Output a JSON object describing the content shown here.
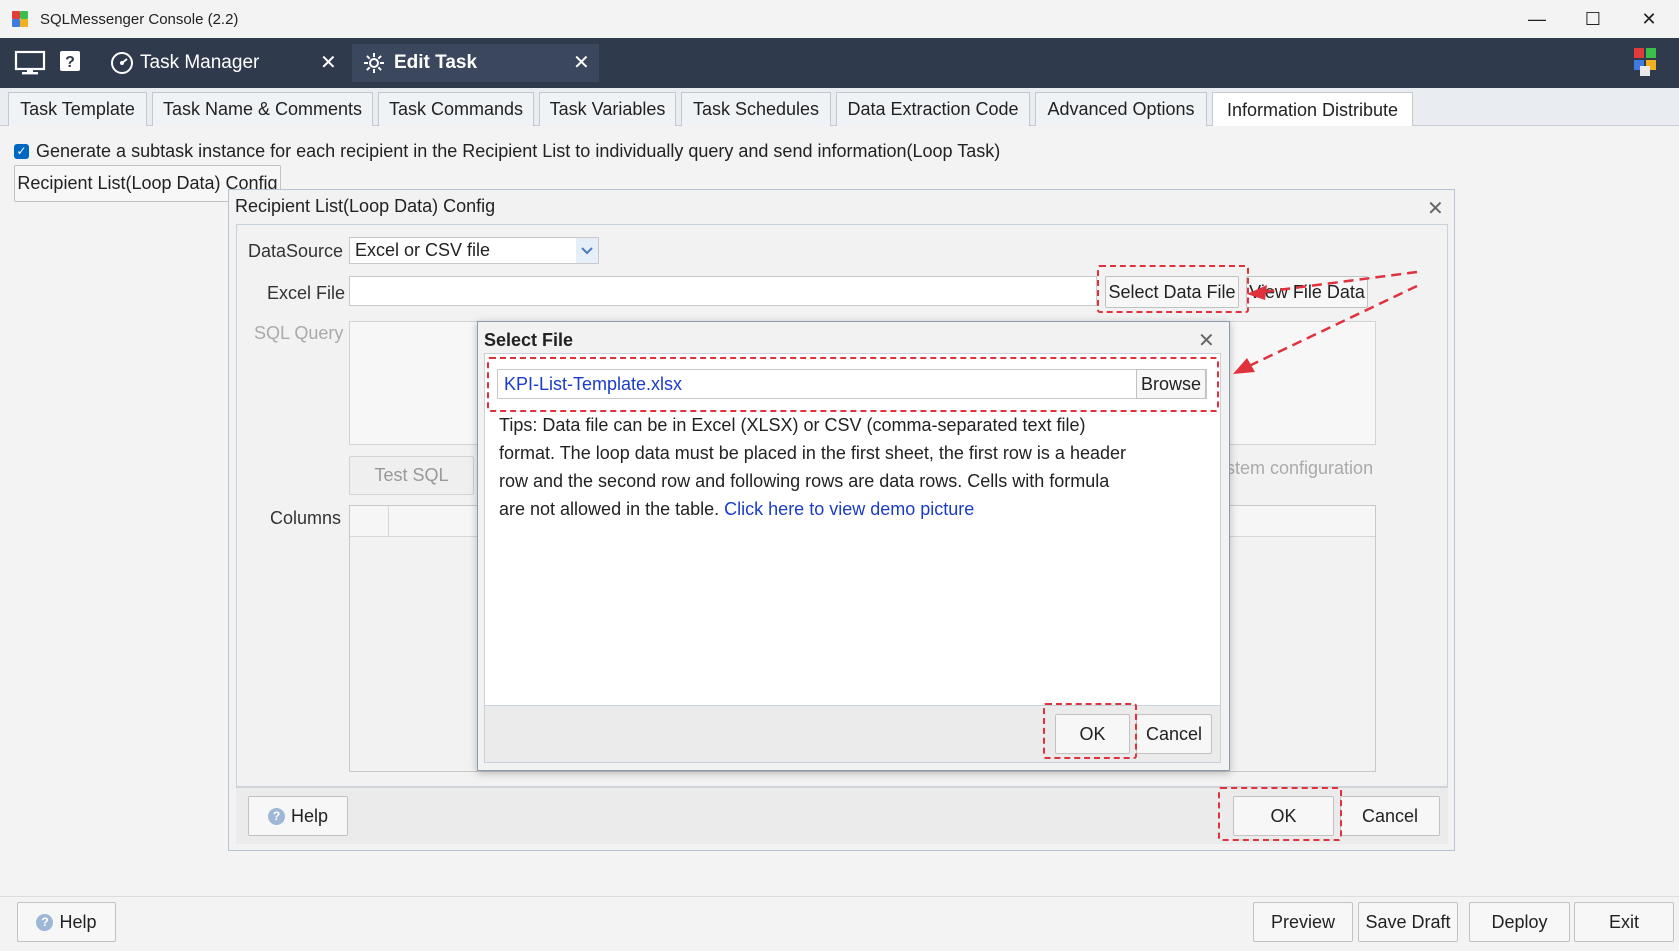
{
  "window": {
    "title": "SQLMessenger Console (2.2)",
    "controls": {
      "minimize": "—",
      "maximize": "☐",
      "close": "✕"
    }
  },
  "nav": {
    "tabs": [
      {
        "label": "Task Manager",
        "active": false
      },
      {
        "label": "Edit Task",
        "active": true
      }
    ],
    "close_glyph": "✕"
  },
  "tabs": [
    "Task Template",
    "Task Name & Comments",
    "Task Commands",
    "Task Variables",
    "Task Schedules",
    "Data Extraction Code",
    "Advanced Options",
    "Information Distribute"
  ],
  "active_tab": "Information Distribute",
  "loop_task": {
    "checked": true,
    "label": "Generate a subtask instance for each recipient in the Recipient List to individually query and send information(Loop Task)",
    "config_button": "Recipient List(Loop Data) Config"
  },
  "config_dialog": {
    "title": "Recipient List(Loop Data) Config",
    "datasource_label": "DataSource",
    "datasource_value": "Excel or CSV file",
    "excel_file_label": "Excel File",
    "excel_file_value": "",
    "select_data_file_button": "Select Data File",
    "view_file_data_button": "View File Data",
    "sql_query_label": "SQL Query",
    "test_sql_button": "Test SQL",
    "system_config_text": "stem configuration",
    "columns_label": "Columns",
    "help_button": "Help",
    "ok_button": "OK",
    "cancel_button": "Cancel"
  },
  "select_file_dialog": {
    "title": "Select File",
    "file_value": "KPI-List-Template.xlsx",
    "browse_button": "Browse",
    "tips_text": "Tips: Data file can be in Excel (XLSX) or CSV (comma-separated text file) format. The loop data must be placed in the first sheet, the first row is a header row and the second row and following rows are data rows. Cells with formula are not allowed in the table.",
    "tips_link": "Click here to view demo picture",
    "ok_button": "OK",
    "cancel_button": "Cancel"
  },
  "footer": {
    "help": "Help",
    "preview": "Preview",
    "save_draft": "Save Draft",
    "deploy": "Deploy",
    "exit": "Exit"
  },
  "colors": {
    "nav_bg": "#2f3a4d",
    "annotation_red": "#e0323d",
    "link_blue": "#1a3cc9",
    "checkbox_blue": "#0067c0"
  }
}
